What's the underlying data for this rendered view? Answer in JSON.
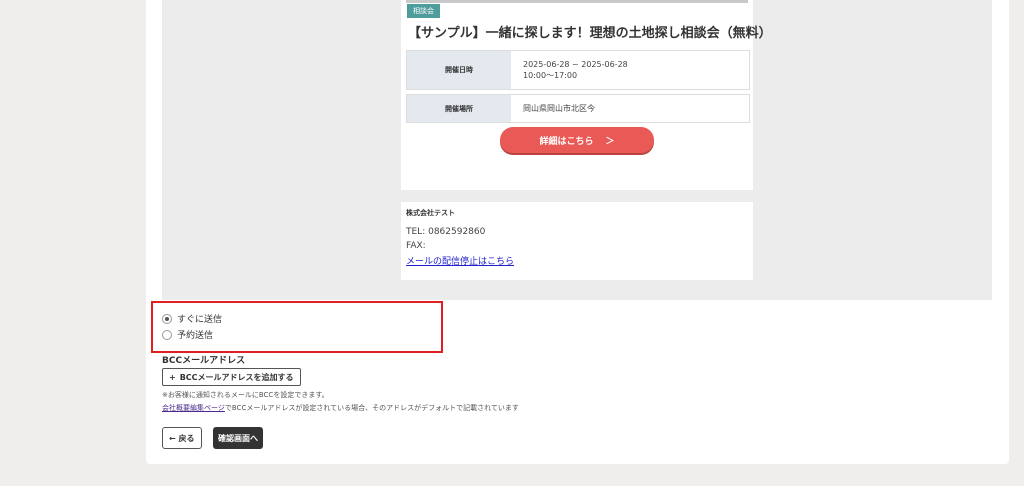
{
  "email_preview": {
    "tag": "相談会",
    "event_title": "【サンプル】一緒に探します！理想の土地探し相談会（無料）",
    "rows": [
      {
        "label": "開催日時",
        "value_line1": "2025-06-28 ~ 2025-06-28",
        "value_line2": "10:00〜17:00"
      },
      {
        "label": "開催場所",
        "value_line1": "岡山県岡山市北区今",
        "value_line2": ""
      }
    ],
    "detail_button": "詳細はこちら",
    "detail_button_arrow": "＞",
    "company": "株式会社テスト",
    "tel": "TEL: 0862592860",
    "fax": "FAX:",
    "unsubscribe": "メールの配信停止はこちら"
  },
  "send_options": [
    {
      "label": "すぐに送信",
      "selected": true
    },
    {
      "label": "予約送信",
      "selected": false
    }
  ],
  "bcc": {
    "heading": "BCCメールアドレス",
    "add_button": "BCCメールアドレスを追加する",
    "add_icon": "+",
    "note1": "※お客様に通知されるメールにBCCを設定できます。",
    "note2_link": "会社概要編集ページ",
    "note2_rest": "でBCCメールアドレスが設定されている場合、そのアドレスがデフォルトで記載されています"
  },
  "actions": {
    "back": "← 戻る",
    "confirm": "確認画面へ"
  },
  "colors": {
    "accent_red": "#e95a57",
    "tag_teal": "#4f9c9c",
    "highlight_border": "#e02020",
    "confirm_bg": "#333333"
  }
}
